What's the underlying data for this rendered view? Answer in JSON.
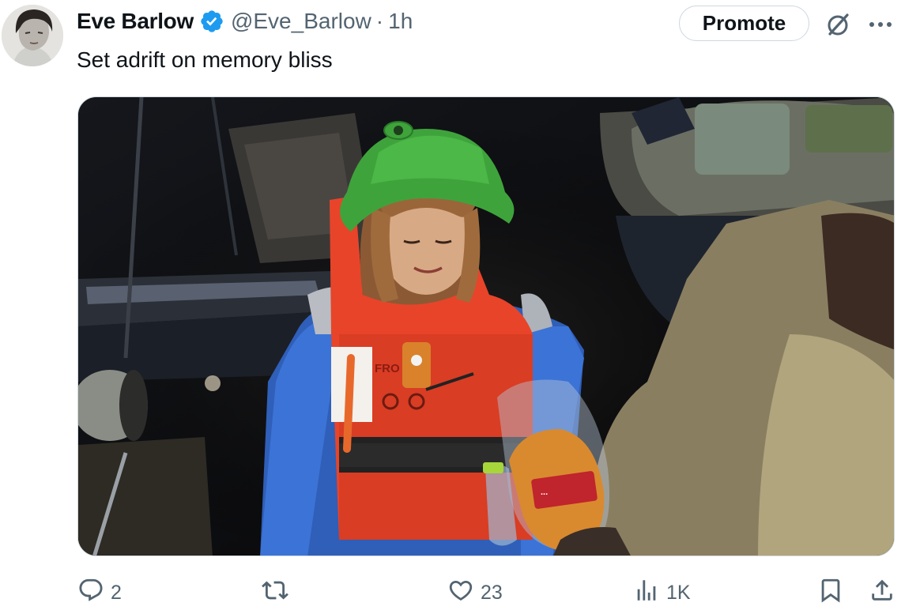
{
  "author": {
    "name": "Eve Barlow",
    "handle": "@Eve_Barlow",
    "separator": "·",
    "time": "1h"
  },
  "promote_label": "Promote",
  "tweet_text": "Set adrift on memory bliss",
  "media": {
    "vest_text": "FRO",
    "bread_label": "...",
    "alt": ""
  },
  "actions": {
    "replies": "2",
    "reposts": "",
    "likes": "23",
    "views": "1K"
  },
  "colors": {
    "text": "#0f1419",
    "secondary": "#536471",
    "verified": "#1d9bf0",
    "border": "#cfd9de"
  },
  "icons": [
    "verified-badge-icon",
    "grok-icon",
    "more-icon",
    "reply-icon",
    "repost-icon",
    "like-icon",
    "views-icon",
    "bookmark-icon",
    "share-icon"
  ]
}
